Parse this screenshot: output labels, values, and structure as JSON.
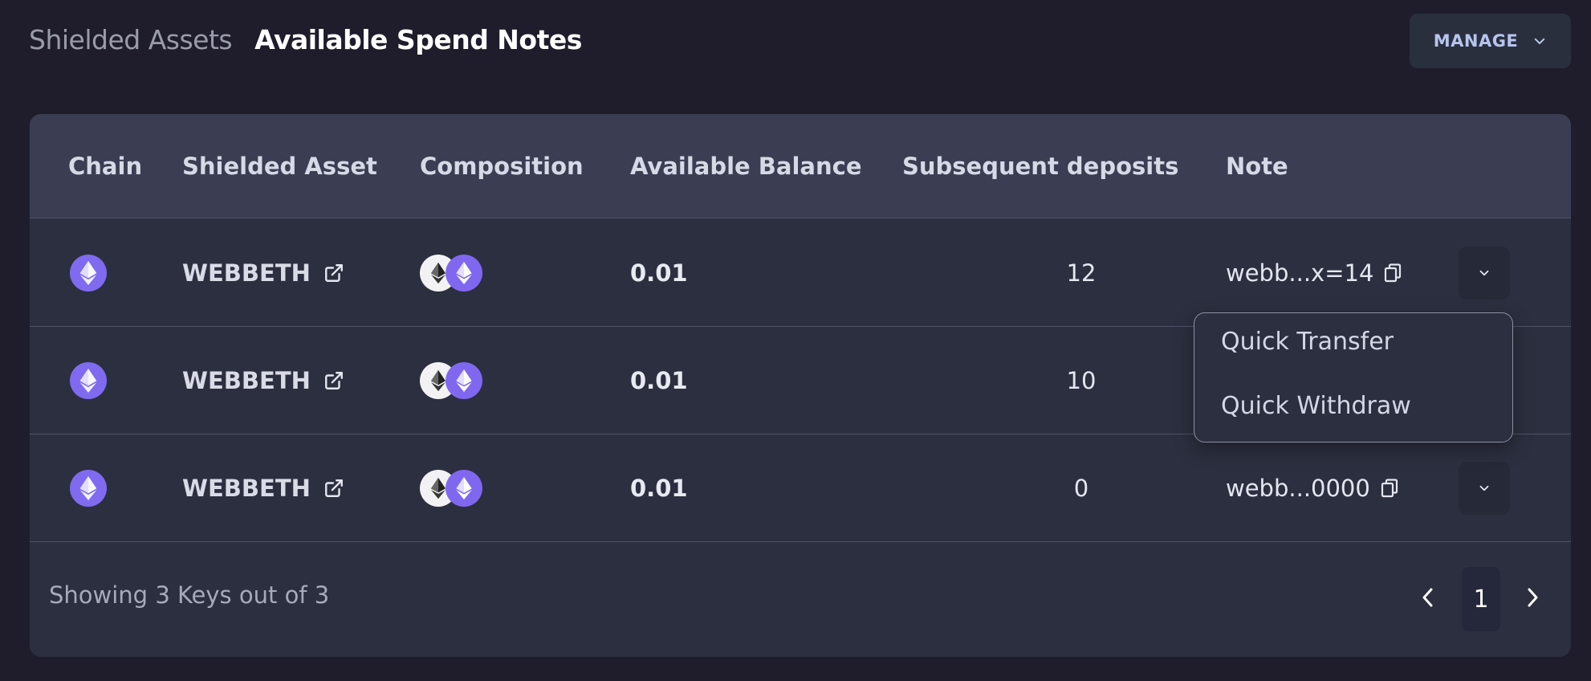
{
  "header": {
    "tab_inactive": "Shielded Assets",
    "tab_active": "Available Spend Notes",
    "manage_label": "MANAGE"
  },
  "table": {
    "columns": [
      "Chain",
      "Shielded Asset",
      "Composition",
      "Available Balance",
      "Subsequent deposits",
      "Note"
    ],
    "rows": [
      {
        "chain_icon": "ethereum-icon",
        "asset": "WEBBETH",
        "balance": "0.01",
        "deposits": "12",
        "note": "webb...x=14"
      },
      {
        "chain_icon": "ethereum-icon",
        "asset": "WEBBETH",
        "balance": "0.01",
        "deposits": "10",
        "note": ""
      },
      {
        "chain_icon": "ethereum-icon",
        "asset": "WEBBETH",
        "balance": "0.01",
        "deposits": "0",
        "note": "webb...0000"
      }
    ]
  },
  "dropdown": {
    "items": [
      "Quick Transfer",
      "Quick Withdraw"
    ]
  },
  "footer": {
    "showing_text": "Showing 3 Keys out of 3",
    "current_page": "1"
  },
  "colors": {
    "background": "#1f1d2b",
    "card": "#2c2f3f",
    "header_row": "#3b3e52",
    "accent_purple": "#7f6af0",
    "manage_text": "#b7c4ee"
  }
}
